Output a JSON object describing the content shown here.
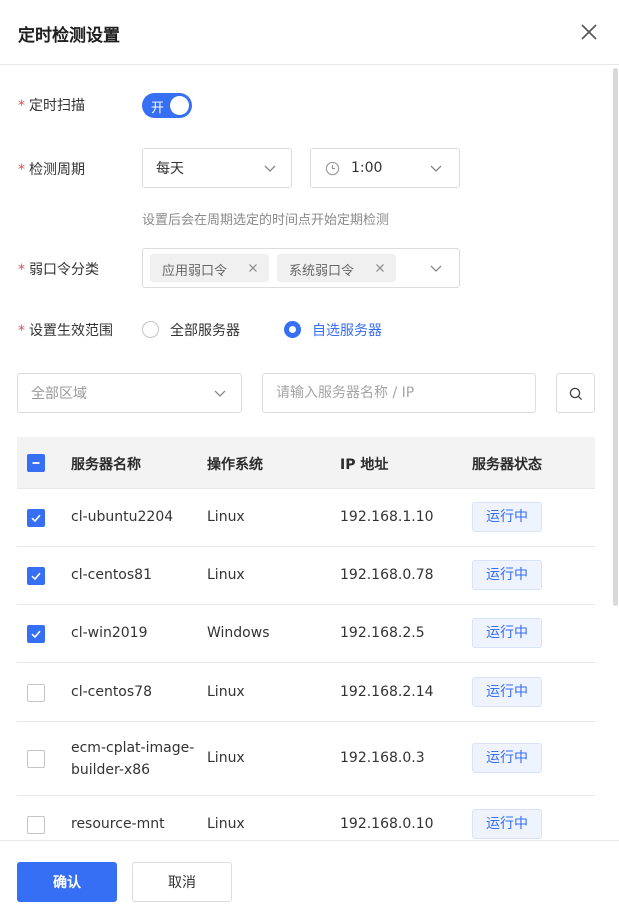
{
  "dialog": {
    "title": "定时检测设置"
  },
  "form": {
    "schedule": {
      "label": "定时扫描",
      "toggle_text": "开",
      "enabled": true
    },
    "period": {
      "label": "检测周期",
      "frequency": "每天",
      "time": "1:00",
      "hint": "设置后会在周期选定的时间点开始定期检测"
    },
    "category": {
      "label": "弱口令分类",
      "tags": [
        "应用弱口令",
        "系统弱口令"
      ]
    },
    "scope": {
      "label": "设置生效范围",
      "options": [
        "全部服务器",
        "自选服务器"
      ],
      "selected": "自选服务器"
    }
  },
  "filter": {
    "region": "全部区域",
    "search_placeholder": "请输入服务器名称 / IP"
  },
  "table": {
    "columns": [
      "服务器名称",
      "操作系统",
      "IP 地址",
      "服务器状态"
    ],
    "rows": [
      {
        "name": "cl-ubuntu2204",
        "os": "Linux",
        "ip": "192.168.1.10",
        "status": "运行中",
        "checked": true
      },
      {
        "name": "cl-centos81",
        "os": "Linux",
        "ip": "192.168.0.78",
        "status": "运行中",
        "checked": true
      },
      {
        "name": "cl-win2019",
        "os": "Windows",
        "ip": "192.168.2.5",
        "status": "运行中",
        "checked": true
      },
      {
        "name": "cl-centos78",
        "os": "Linux",
        "ip": "192.168.2.14",
        "status": "运行中",
        "checked": false
      },
      {
        "name_line1": "ecm-cplat-image-",
        "name_line2": "builder-x86",
        "os": "Linux",
        "ip": "192.168.0.3",
        "status": "运行中",
        "checked": false
      },
      {
        "name": "resource-mnt",
        "os": "Linux",
        "ip": "192.168.0.10",
        "status": "运行中",
        "checked": false
      }
    ]
  },
  "footer": {
    "confirm": "确认",
    "cancel": "取消"
  },
  "colors": {
    "primary": "#366ef4",
    "required": "#e34d59"
  }
}
